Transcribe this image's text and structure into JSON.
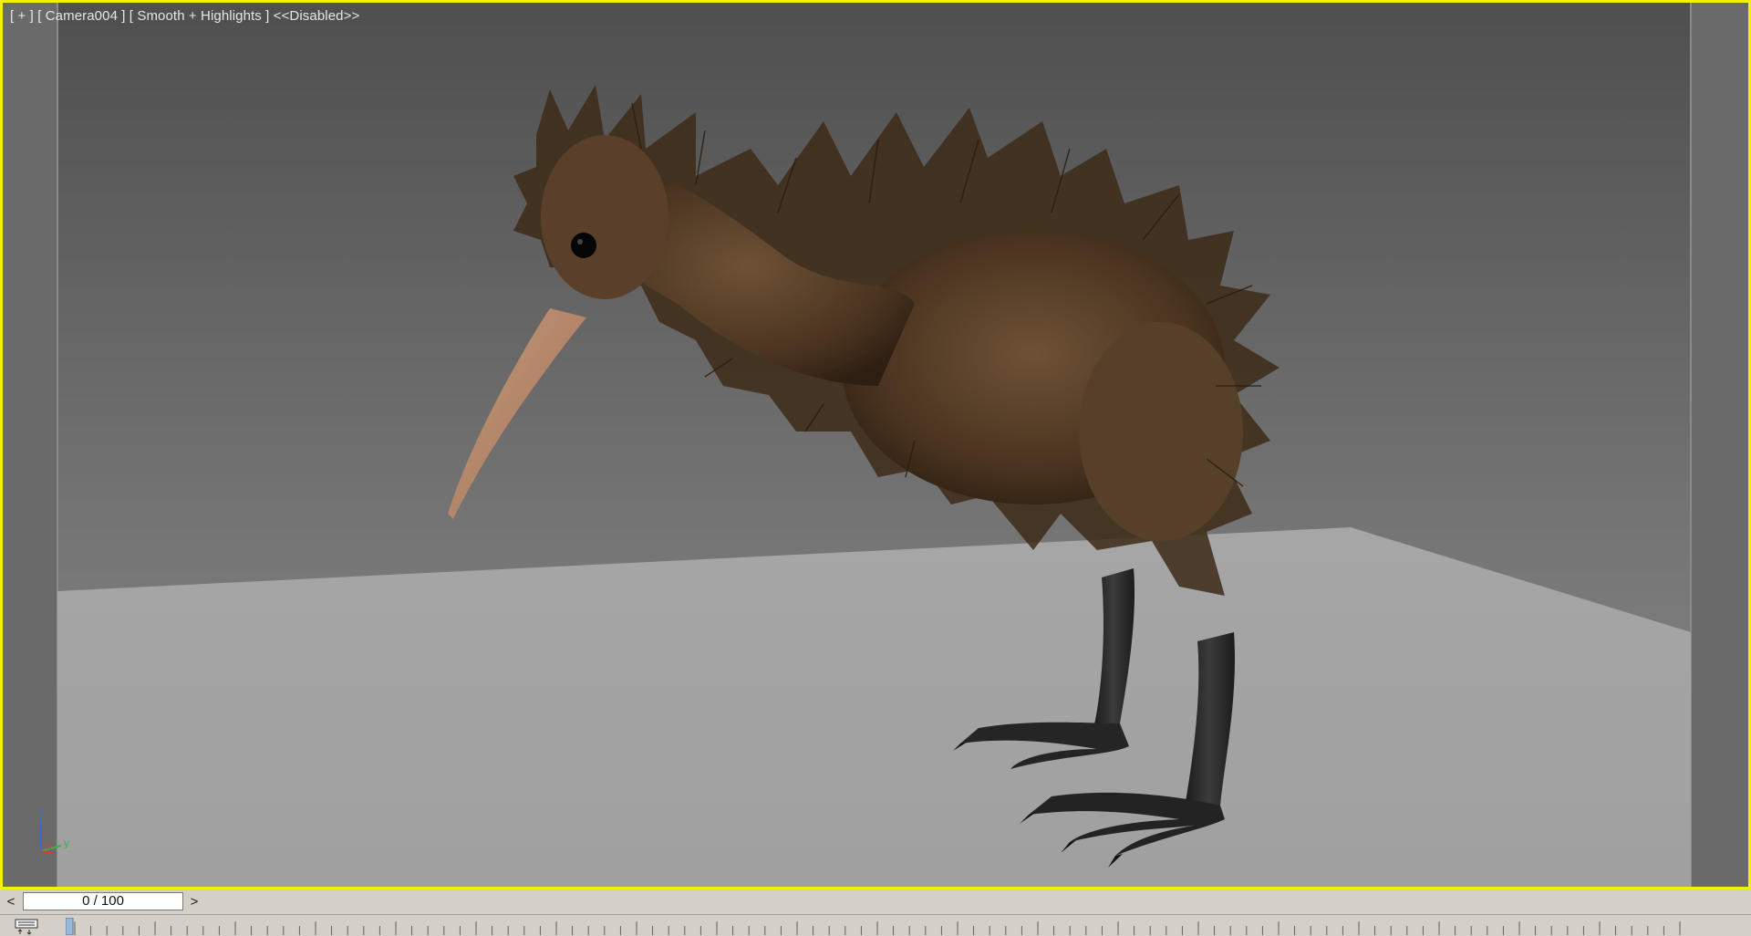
{
  "viewport": {
    "label": "[ + ] [ Camera004 ] [ Smooth + Highlights ] <<Disabled>>",
    "scene_subject": "kiwi bird with hair/fur on a ground plane",
    "border_color": "#f2f200"
  },
  "axis_tripod": {
    "z": "z",
    "x": "x",
    "y": "y"
  },
  "time_slider": {
    "prev": "<",
    "value": "0 / 100",
    "next": ">"
  },
  "trackbar": {
    "icon": "filter-icon",
    "range_start": 0,
    "range_end": 100
  },
  "colors": {
    "ui_gray": "#d4d0c8",
    "selection_yellow": "#f2f200"
  }
}
